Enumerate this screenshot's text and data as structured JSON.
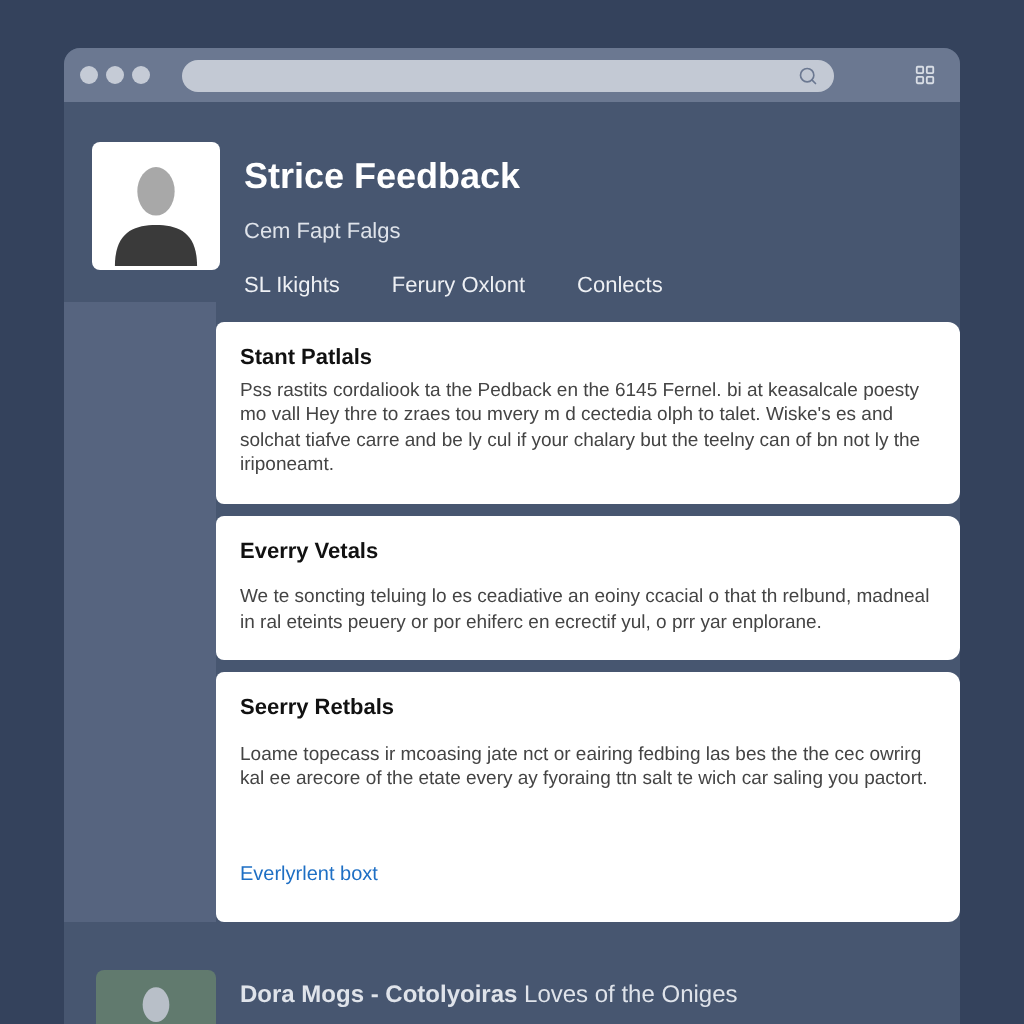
{
  "profile": {
    "name": "Strice Feedback",
    "subtitle": "Cem Fapt Falgs"
  },
  "tabs": [
    {
      "label": "SL Ikights",
      "selected": false
    },
    {
      "label": "Ferury Oxlont",
      "selected": false
    },
    {
      "label": "Conlects",
      "selected": false
    }
  ],
  "cards": [
    {
      "title": "Stant Patlals",
      "body": "Pss rastits cordaliook ta the Pedback en the 6145 Fernel. bi at keasalcale poesty mo vall Hey thre to zraes tou mvery m d cectedia olph to talet. Wiske's es and solchat tiafve carre and be ly cul if your chalary but the teelny can of bn not ly the iriponeamt."
    },
    {
      "title": "Everry Vetals",
      "body": "We te soncting teluing lo es ceadiative an eoiny ccacial o that th relbund, madneal in ral eteints peuery or por ehiferc en ecrectif yul, o prr yar enplorane."
    },
    {
      "title": "Seerry Retbals",
      "body": "Loame topecass ir mcoasing jate nct or eairing fedbing las bes the the cec owrirg kal ee arecore of the etate every ay fyoraing ttn salt te wich car saling you pactort.",
      "link": "Everlyrlent boxt"
    }
  ],
  "feed_item": {
    "headline": "**Dora Mogs - Cotolyoiras** Loves of the Oniges"
  }
}
